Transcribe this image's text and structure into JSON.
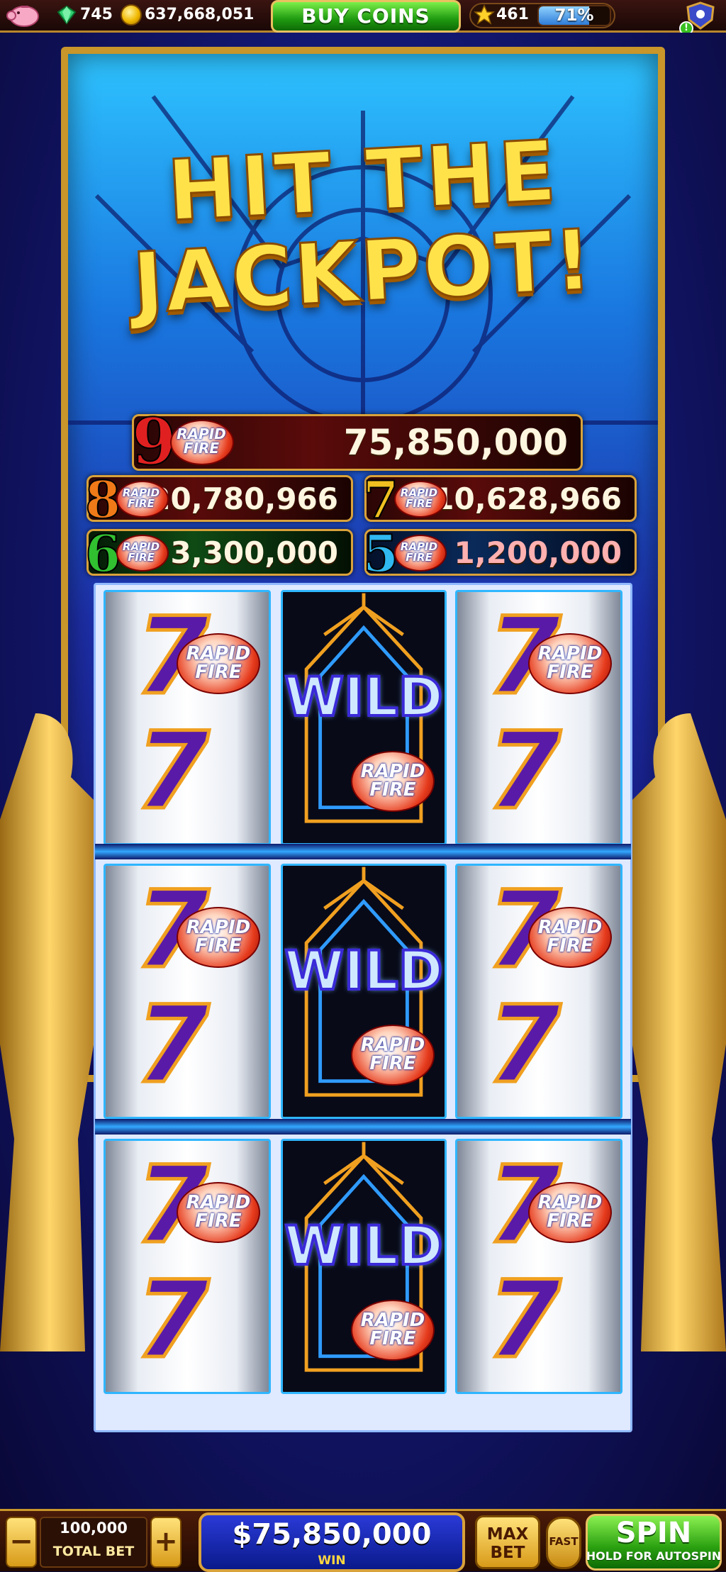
{
  "topbar": {
    "gems": "745",
    "coins": "637,668,051",
    "buy_label": "BUY COINS",
    "level": "461",
    "xp_percent": "71%",
    "xp_fraction": 0.71,
    "notification_badge": "!"
  },
  "title": {
    "line1": "HIT THE",
    "line2": "JACKPOT!"
  },
  "jackpots": [
    {
      "tier": "9",
      "value": "75,850,000",
      "badge": "RAPID FIRE",
      "tier_color": "#e02020"
    },
    {
      "tier": "8",
      "value": "20,780,966",
      "badge": "RAPID FIRE",
      "tier_color": "#f07a18"
    },
    {
      "tier": "7",
      "value": "10,628,966",
      "badge": "RAPID FIRE",
      "tier_color": "#f0c020"
    },
    {
      "tier": "6",
      "value": "3,300,000",
      "badge": "RAPID FIRE",
      "tier_color": "#30c030"
    },
    {
      "tier": "5",
      "value": "1,200,000",
      "badge": "RAPID FIRE",
      "tier_color": "#30b8f0"
    }
  ],
  "reels": {
    "rows": [
      [
        "77 RAPID FIRE",
        "WILD RAPID FIRE",
        "77 RAPID FIRE"
      ],
      [
        "77 RAPID FIRE",
        "WILD RAPID FIRE",
        "77 RAPID FIRE"
      ],
      [
        "77 RAPID FIRE",
        "WILD RAPID FIRE",
        "77 RAPID FIRE"
      ]
    ],
    "seven_glyph": "7",
    "wild_label": "WILD",
    "rapid_word": "RAPID",
    "fire_word": "FIRE"
  },
  "bottombar": {
    "minus": "−",
    "plus": "+",
    "bet_value": "100,000",
    "bet_label": "TOTAL BET",
    "win_value": "$75,850,000",
    "win_label": "WIN",
    "maxbet_line1": "MAX",
    "maxbet_line2": "BET",
    "fast_label": "FAST",
    "spin_label": "SPIN",
    "spin_sub": "HOLD FOR AUTOSPIN"
  },
  "colors": {
    "accent_gold": "#d9a23a",
    "jackpot_text": "#ffe24a",
    "spin_green": "#2aa010",
    "reel_blue": "#2fb6ff"
  }
}
